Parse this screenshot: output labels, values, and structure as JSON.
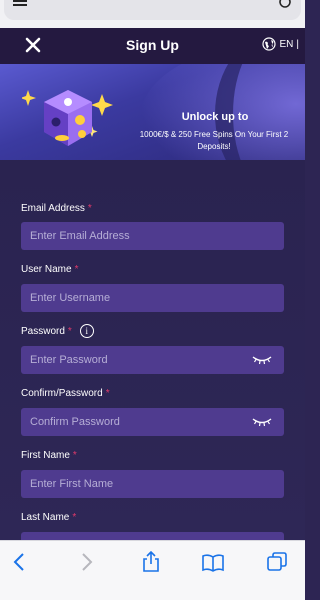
{
  "header": {
    "title": "Sign Up",
    "language": "EN"
  },
  "banner": {
    "headline": "Unlock up to",
    "subtext": "1000€/$ & 250 Free Spins On Your First 2 Deposits!"
  },
  "form": {
    "email": {
      "label": "Email Address",
      "placeholder": "Enter Email Address"
    },
    "username": {
      "label": "User Name",
      "placeholder": "Enter Username"
    },
    "password": {
      "label": "Password",
      "placeholder": "Enter Password"
    },
    "confirm_password": {
      "label": "Confirm/Password",
      "placeholder": "Confirm Password"
    },
    "first_name": {
      "label": "First Name",
      "placeholder": "Enter First Name"
    },
    "last_name": {
      "label": "Last Name"
    },
    "required_mark": "*",
    "info_glyph": "i"
  },
  "colors": {
    "header_bg": "#241940",
    "page_bg": "#2d2553",
    "field_bg": "#4f3b8f",
    "required": "#e23a6b",
    "browser_accent": "#1a73e8"
  },
  "icons": [
    "menu-icon",
    "reload-icon",
    "close-icon",
    "globe-icon",
    "dice-mascot-illustration",
    "eye-closed-icon",
    "info-icon",
    "back-icon",
    "forward-icon",
    "share-icon",
    "bookmarks-icon",
    "tabs-icon"
  ]
}
